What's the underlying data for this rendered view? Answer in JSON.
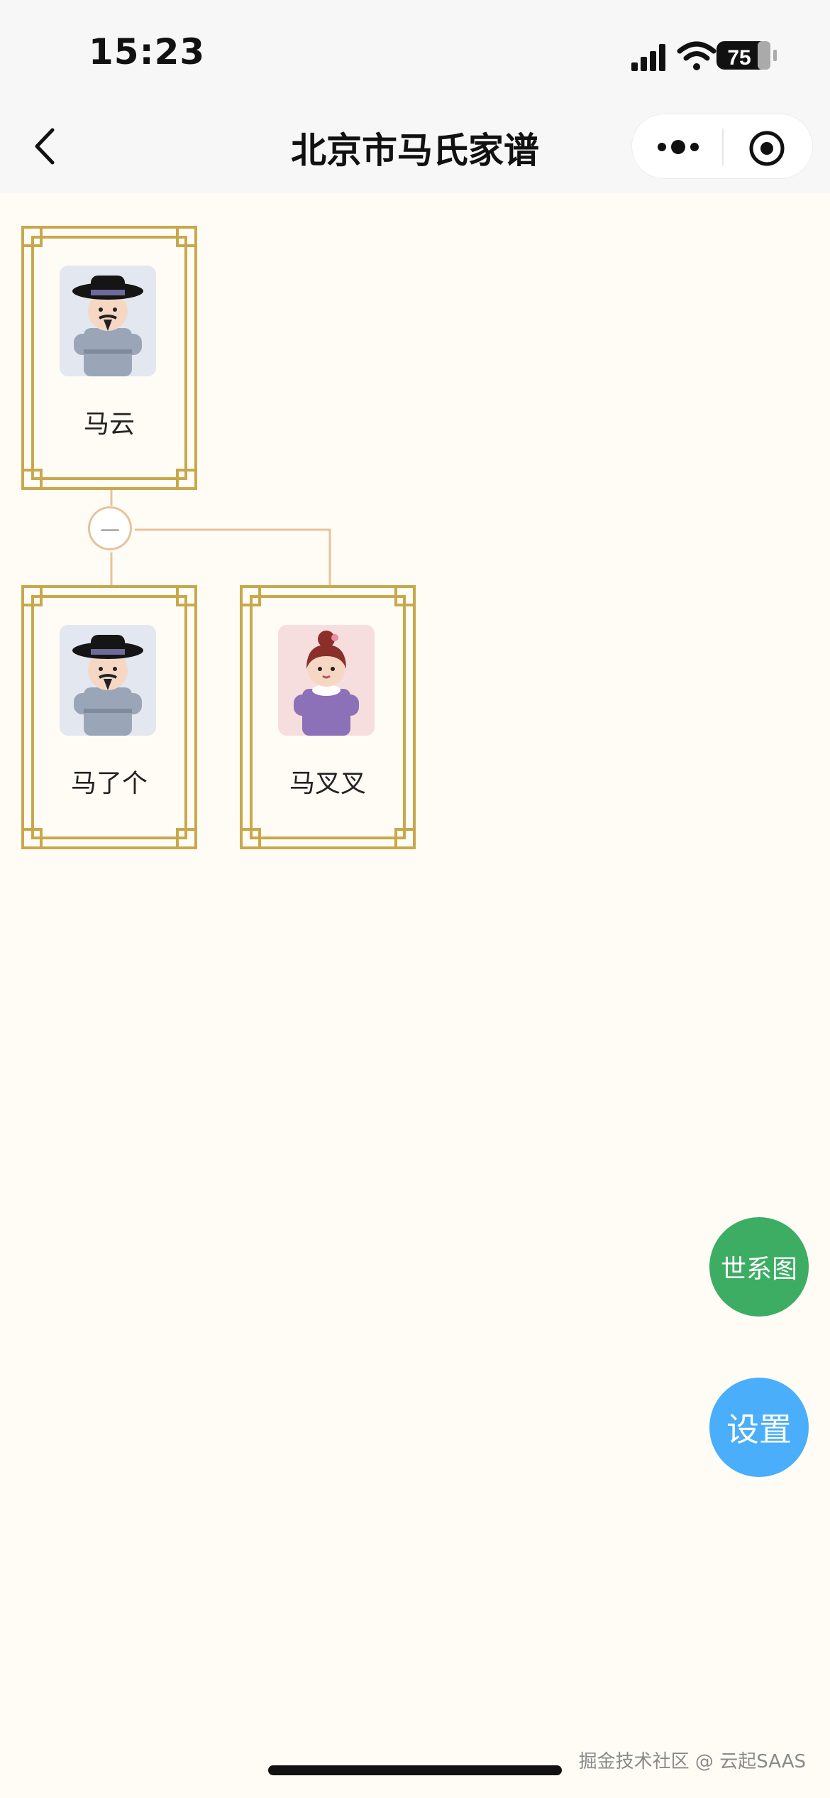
{
  "status_bar": {
    "time": "15:23",
    "battery": "75"
  },
  "nav": {
    "title": "北京市马氏家谱"
  },
  "tree": {
    "root": {
      "name": "马云",
      "avatar": "male-avatar"
    },
    "children": [
      {
        "name": "马了个",
        "avatar": "male-avatar"
      },
      {
        "name": "马叉叉",
        "avatar": "female-avatar"
      }
    ],
    "collapse_symbol": "—"
  },
  "actions": {
    "lineage_label": "世系图",
    "settings_label": "设置"
  },
  "footer": {
    "watermark": "掘金技术社区 @ 云起SAAS"
  },
  "colors": {
    "frame_gold": "#c9a84c",
    "lineage_green": "#3dad63",
    "settings_blue": "#4aaefa",
    "connector": "#e8c29c"
  }
}
